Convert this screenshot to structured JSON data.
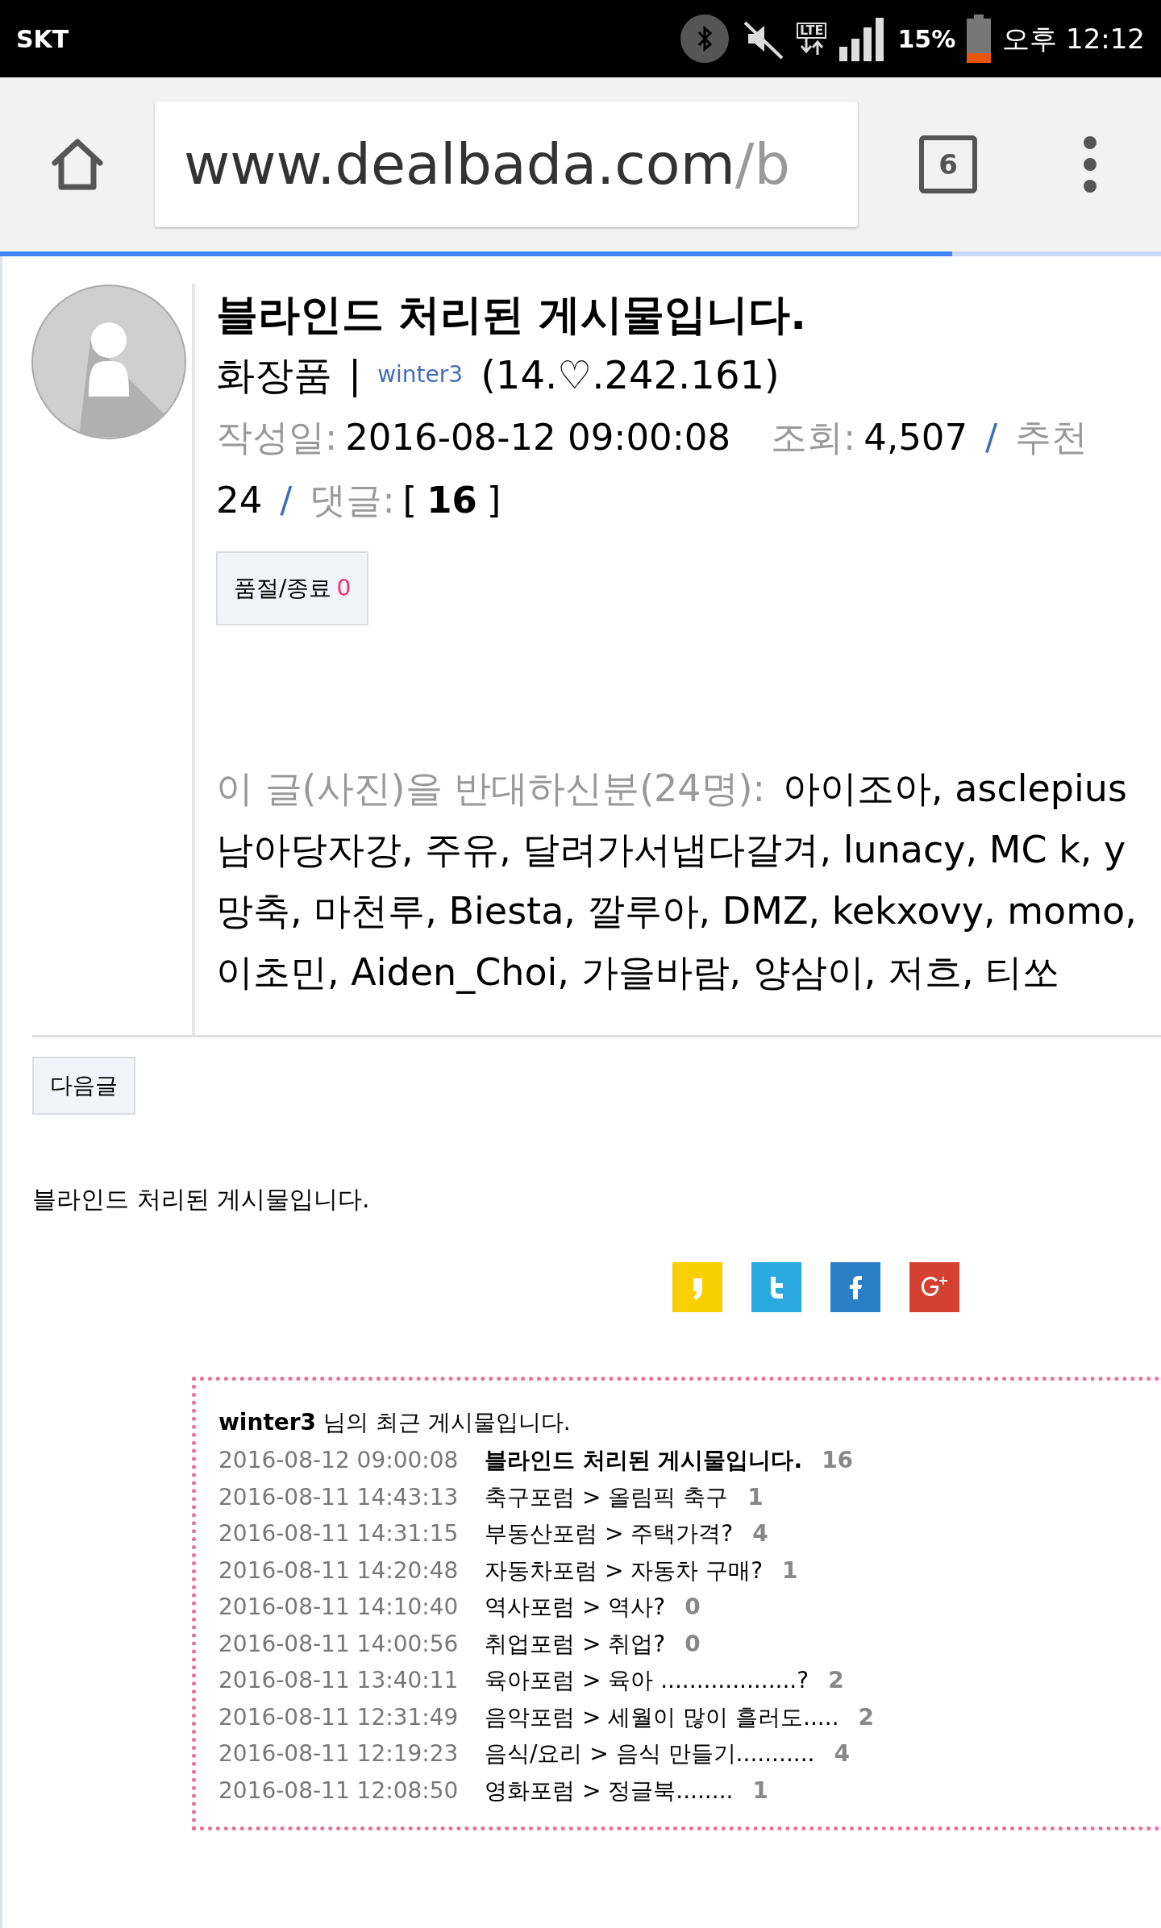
{
  "status_bar": {
    "carrier": "SKT",
    "network": "LTE",
    "battery": "15%",
    "time": "오후 12:12"
  },
  "browser": {
    "url_host": "www.dealbada.com",
    "url_path": "/b",
    "tab_count": "6",
    "load_progress": {
      "level": 0.82
    }
  },
  "post": {
    "title": "블라인드 처리된 게시물입니다.",
    "category": "화장품",
    "separator": "|",
    "author": "winter3",
    "ip": "(14.♡.242.161)",
    "meta_lines": [
      [
        {
          "kind": "label",
          "text": "작성일:"
        },
        {
          "kind": "value",
          "text": "2016-08-12 09:00:08"
        },
        {
          "kind": "label",
          "text": "조회:"
        },
        {
          "kind": "value",
          "text": "4,507"
        },
        {
          "kind": "slash",
          "text": "/"
        },
        {
          "kind": "label",
          "text": "추천"
        }
      ],
      [
        {
          "kind": "value",
          "text": "24"
        },
        {
          "kind": "slash",
          "text": "/"
        },
        {
          "kind": "label",
          "text": "댓글:"
        },
        {
          "kind": "bracket",
          "text": "["
        },
        {
          "kind": "count",
          "text": "16"
        },
        {
          "kind": "bracket",
          "text": "]"
        }
      ]
    ],
    "sold_out_button": {
      "label": "품절/종료",
      "count": "0"
    },
    "opposers": {
      "label": "이 글(사진)을 반대하신분(24명):",
      "lines": [
        "아이조아, asclepius",
        "남아당자강, 주유, 달려가서냅다갈겨, lunacy, MC k, y",
        "망축, 마천루, Biesta, 깔루아, DMZ, kekxovy, momo,",
        "이초민, Aiden_Choi, 가을바람, 양삼이, 저흐, 티쏘"
      ]
    }
  },
  "next_button": "다음글",
  "body_text": "블라인드 처리된 게시물입니다.",
  "share_buttons": [
    {
      "kind": "kakaostory"
    },
    {
      "kind": "twitter"
    },
    {
      "kind": "facebook"
    },
    {
      "kind": "googleplus"
    }
  ],
  "recent_posts": {
    "user": "winter3",
    "heading": "님의 최근 게시물입니다.",
    "rows": [
      {
        "date": "2016-08-12 09:00:08",
        "title": "블라인드 처리된 게시물입니다.",
        "count": "16",
        "highlighted": true
      },
      {
        "date": "2016-08-11 14:43:13",
        "title": "축구포럼 > 올림픽 축구",
        "count": "1",
        "highlighted": false
      },
      {
        "date": "2016-08-11 14:31:15",
        "title": "부동산포럼 > 주택가격?",
        "count": "4",
        "highlighted": false
      },
      {
        "date": "2016-08-11 14:20:48",
        "title": "자동차포럼 > 자동차 구매?",
        "count": "1",
        "highlighted": false
      },
      {
        "date": "2016-08-11 14:10:40",
        "title": "역사포럼 > 역사?",
        "count": "0",
        "highlighted": false
      },
      {
        "date": "2016-08-11 14:00:56",
        "title": "취업포럼 > 취업?",
        "count": "0",
        "highlighted": false
      },
      {
        "date": "2016-08-11 13:40:11",
        "title": "육아포럼 > 육아 ...................?",
        "count": "2",
        "highlighted": false
      },
      {
        "date": "2016-08-11 12:31:49",
        "title": "음악포럼 > 세월이 많이 흘러도.....",
        "count": "2",
        "highlighted": false
      },
      {
        "date": "2016-08-11 12:19:23",
        "title": "음식/요리 > 음식 만들기...........",
        "count": "4",
        "highlighted": false
      },
      {
        "date": "2016-08-11 12:08:50",
        "title": "영화포럼 > 정글북........",
        "count": "1",
        "highlighted": false
      }
    ]
  }
}
